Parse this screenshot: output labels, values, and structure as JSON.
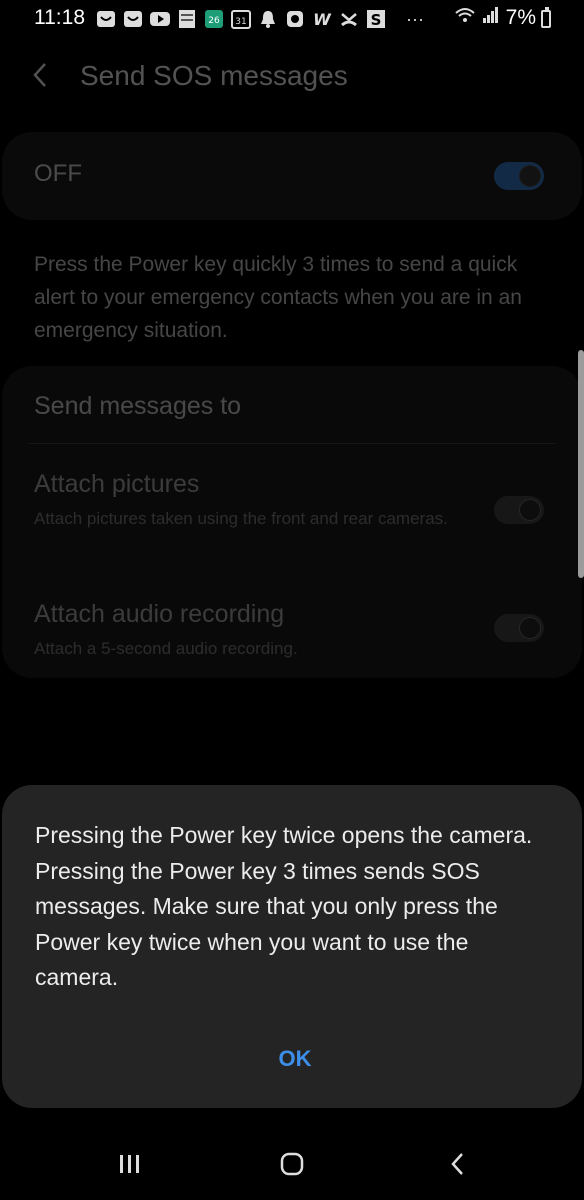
{
  "status_bar": {
    "time": "11:18",
    "battery": "7%",
    "icons": [
      "samsung-icon",
      "samsung-icon",
      "youtube-icon",
      "bible-icon",
      "calendar-26-icon",
      "calendar-31-icon",
      "bell-icon",
      "app-icon",
      "w-icon",
      "call-icon",
      "s-icon",
      "more-icon"
    ],
    "calendar_a": "26",
    "calendar_b": "31",
    "s_letter": "S",
    "w_letter": "W",
    "more": "···"
  },
  "appbar": {
    "title": "Send SOS messages"
  },
  "master_switch": {
    "label": "OFF",
    "state": "off"
  },
  "description": "Press the Power key quickly 3 times to send a quick alert to your emergency contacts when you are in an emergency situation.",
  "settings": {
    "send_to": "Send messages to",
    "attach_pictures": {
      "title": "Attach pictures",
      "subtitle": "Attach pictures taken using the front and rear cameras."
    },
    "attach_audio": {
      "title": "Attach audio recording",
      "subtitle": "Attach a 5-second audio recording."
    }
  },
  "dialog": {
    "message": "Pressing the Power key twice opens the camera. Pressing the Power key 3 times sends SOS messages. Make sure that you only press the Power key twice when you want to use the camera.",
    "ok_label": "OK",
    "ok_color": "#3d8ee8"
  },
  "nav": {
    "recents": "recents-icon",
    "home": "home-icon",
    "back": "back-icon"
  }
}
